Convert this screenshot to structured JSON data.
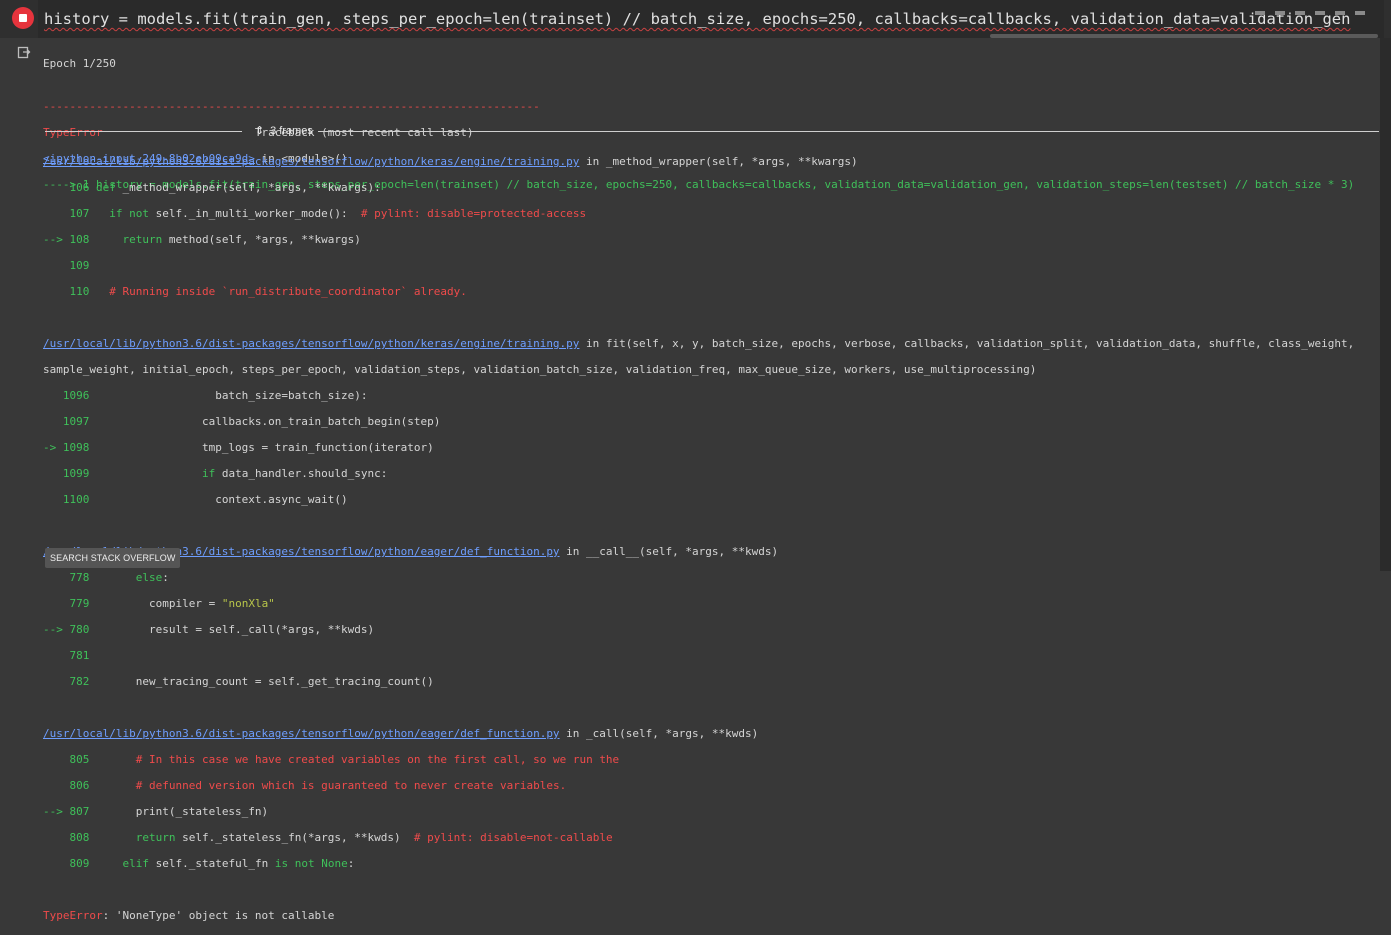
{
  "cell": {
    "code": "history = models.fit(train_gen, steps_per_epoch=len(trainset) // batch_size, epochs=250, callbacks=callbacks, validation_data=validation_gen"
  },
  "output": {
    "epoch_line": "Epoch 1/250",
    "dash_line": "---------------------------------------------------------------------------",
    "error_type": "TypeError",
    "traceback_header": "                       Traceback (most recent call last)",
    "input_link": "<ipython-input-249-8b02eb09ca9d>",
    "input_in": " in <module>()",
    "arrow_line": "----> 1 history = models.fit(train_gen, steps_per_epoch=len(trainset) // batch_size, epochs=250, callbacks=callbacks, validation_data=validation_gen, validation_steps=len(testset) // batch_size * 3)",
    "frames_label": "3 frames",
    "frames": [
      {
        "file": "/usr/local/lib/python3.6/dist-packages/tensorflow/python/keras/engine/training.py",
        "in": " in _method_wrapper(self, *args, **kwargs)",
        "cont": ""
      },
      {
        "file": "/usr/local/lib/python3.6/dist-packages/tensorflow/python/keras/engine/training.py",
        "in": " in fit(self, x, y, batch_size, epochs, verbose, callbacks, validation_split, validation_data, shuffle, class_weight,",
        "cont": "sample_weight, initial_epoch, steps_per_epoch, validation_steps, validation_batch_size, validation_freq, max_queue_size, workers, use_multiprocessing)"
      },
      {
        "file": "/usr/local/lib/python3.6/dist-packages/tensorflow/python/eager/def_function.py",
        "in": " in __call__(self, *args, **kwds)",
        "cont": ""
      },
      {
        "file": "/usr/local/lib/python3.6/dist-packages/tensorflow/python/eager/def_function.py",
        "in": " in _call(self, *args, **kwds)",
        "cont": ""
      }
    ],
    "final_error_type": "TypeError",
    "final_error_msg": ": 'NoneType' object is not callable"
  },
  "buttons": {
    "search_so": "SEARCH STACK OVERFLOW"
  }
}
